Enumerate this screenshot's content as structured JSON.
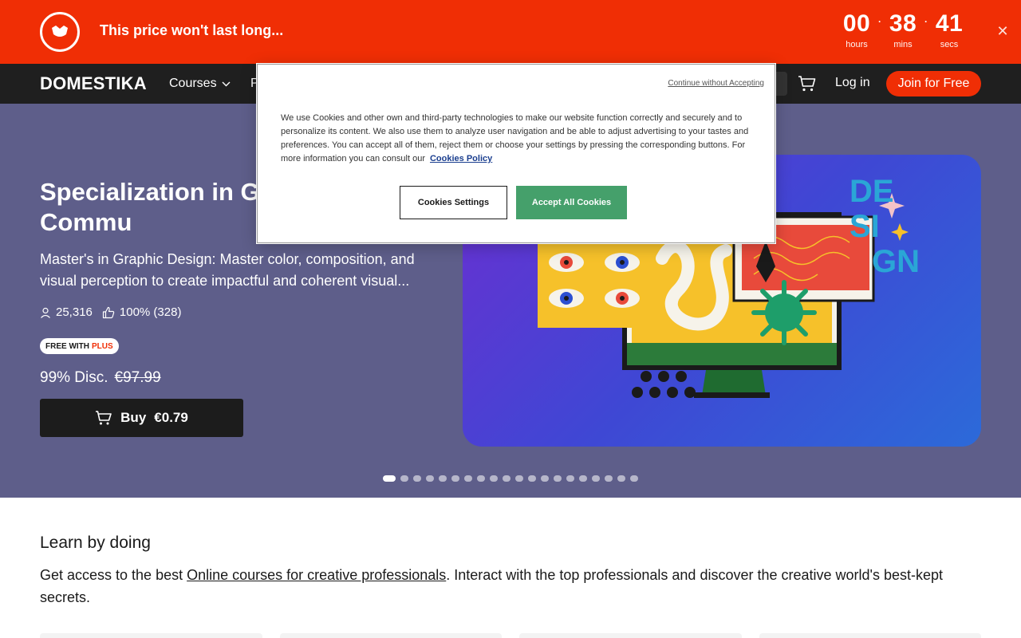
{
  "promo": {
    "text": "This price won't last long...",
    "countdown": [
      {
        "value": "00",
        "label": "hours"
      },
      {
        "value": "38",
        "label": "mins"
      },
      {
        "value": "41",
        "label": "secs"
      }
    ],
    "close_icon": "close-icon",
    "accent": "#f02e05"
  },
  "nav": {
    "brand": "DOMESTIKA",
    "courses": "Courses",
    "partial_item": "P",
    "login": "Log in",
    "join": "Join for Free"
  },
  "hero": {
    "title": "Specialization in Gr and Visual Commu",
    "subtitle": "Master's in Graphic Design: Master color, composition, and visual perception to create impactful and coherent visual...",
    "students": "25,316",
    "rating": "100% (328)",
    "badge_free_with": "FREE WITH",
    "badge_plus": "PLUS",
    "discount": "99% Disc.",
    "old_price": "€97.99",
    "buy_label": "Buy",
    "buy_price": "€0.79",
    "art_text_1": "DE",
    "art_text_2": "SI",
    "art_text_3": "GN",
    "slides_total": 20,
    "slide_active": 1
  },
  "cookie": {
    "continue_without": "Continue without Accepting",
    "body": "We use Cookies and other own and third-party technologies to make our website function correctly and securely and to personalize its content. We also use them to analyze user navigation and be able to adjust advertising to your tastes and preferences. You can accept all of them, reject them or choose your settings by pressing the corresponding buttons. For more information you can consult our",
    "policy_link": "Cookies Policy",
    "settings_button": "Cookies Settings",
    "accept_button": "Accept All Cookies"
  },
  "learn": {
    "title": "Learn by doing",
    "text_before": "Get access to the best ",
    "link": "Online courses for creative professionals",
    "text_after": ". Interact with the top professionals and discover the creative world's best-kept secrets."
  }
}
